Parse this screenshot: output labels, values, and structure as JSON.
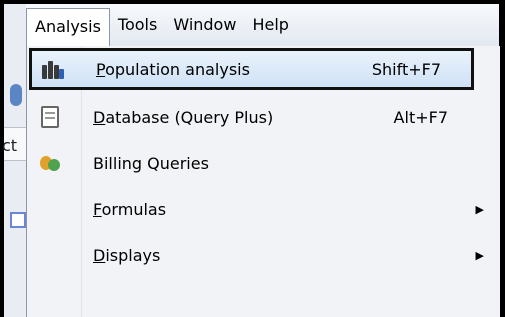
{
  "menubar": {
    "items": [
      {
        "label": "Analysis"
      },
      {
        "label": "Tools"
      },
      {
        "label": "Window"
      },
      {
        "label": "Help"
      }
    ]
  },
  "left_strip": {
    "tab_label": "ct"
  },
  "menu": {
    "items": [
      {
        "label_prefix": "",
        "mnemonic": "P",
        "label_rest": "opulation analysis",
        "accel": "Shift+F7",
        "icon": "binoculars-icon",
        "selected": true
      },
      {
        "label_prefix": "",
        "mnemonic": "D",
        "label_rest": "atabase (Query Plus)",
        "accel": "Alt+F7",
        "icon": "database-query-icon"
      },
      {
        "label_prefix": "Billing Queries",
        "mnemonic": "",
        "label_rest": "",
        "accel": "",
        "icon": "billing-coins-icon"
      },
      {
        "label_prefix": "",
        "mnemonic": "F",
        "label_rest": "ormulas",
        "accel": "",
        "submenu": true
      },
      {
        "label_prefix": "",
        "mnemonic": "D",
        "label_rest": "isplays",
        "accel": "",
        "submenu": true
      }
    ]
  },
  "colors": {
    "selection_top": "#e9f2fc",
    "selection_bottom": "#cfe2f6",
    "menu_bg": "#f1f3f7"
  }
}
